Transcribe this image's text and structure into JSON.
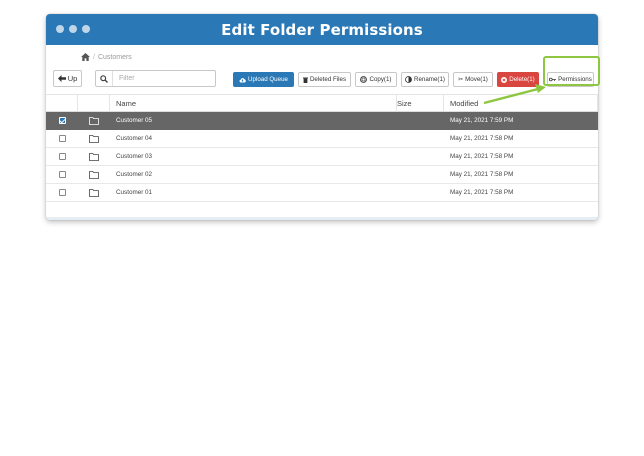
{
  "window": {
    "title": "Edit Folder Permissions"
  },
  "breadcrumb": {
    "path": "Customers"
  },
  "toolbar": {
    "up_label": "Up",
    "filter_placeholder": "Filter",
    "upload_label": "Upload Queue",
    "deleted_label": "Deleted Files",
    "copy_label": "Copy(1)",
    "rename_label": "Rename(1)",
    "move_label": "Move(1)",
    "delete_label": "Delete(1)",
    "permissions_label": "Permissions"
  },
  "table": {
    "headers": {
      "name": "Name",
      "size": "Size",
      "modified": "Modified"
    },
    "rows": [
      {
        "name": "Customer 05",
        "size": "",
        "modified": "May 21, 2021 7:59 PM",
        "checked": true
      },
      {
        "name": "Customer 04",
        "size": "",
        "modified": "May 21, 2021 7:58 PM",
        "checked": false
      },
      {
        "name": "Customer 03",
        "size": "",
        "modified": "May 21, 2021 7:58 PM",
        "checked": false
      },
      {
        "name": "Customer 02",
        "size": "",
        "modified": "May 21, 2021 7:58 PM",
        "checked": false
      },
      {
        "name": "Customer 01",
        "size": "",
        "modified": "May 21, 2021 7:58 PM",
        "checked": false
      }
    ]
  },
  "colors": {
    "titlebar": "#2a78b5",
    "selected_row": "#666666",
    "delete_button": "#d9453f",
    "highlight": "#8dc63f"
  }
}
